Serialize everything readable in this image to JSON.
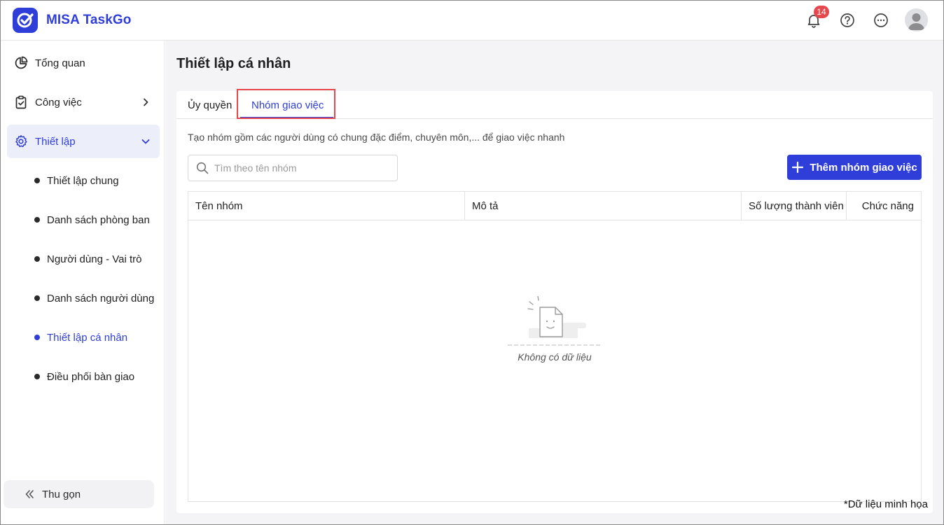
{
  "app": {
    "name": "MISA TaskGo",
    "notification_count": "14",
    "brand_color": "#2f3ed8"
  },
  "header": {
    "icons": [
      "bell-icon",
      "help-icon",
      "more-icon",
      "avatar"
    ]
  },
  "sidebar": {
    "items": [
      {
        "label": "Tổng quan",
        "icon": "pie-chart-icon"
      },
      {
        "label": "Công việc",
        "icon": "clipboard-check-icon"
      },
      {
        "label": "Thiết lập",
        "icon": "gear-icon"
      }
    ],
    "sub_items": [
      {
        "label": "Thiết lập chung"
      },
      {
        "label": "Danh sách phòng ban"
      },
      {
        "label": "Người dùng - Vai trò"
      },
      {
        "label": "Danh sách người dùng"
      },
      {
        "label": "Thiết lập cá nhân"
      },
      {
        "label": "Điều phối bàn giao"
      }
    ],
    "collapse_label": "Thu gọn"
  },
  "main": {
    "page_title": "Thiết lập cá nhân",
    "tabs": [
      {
        "label": "Ủy quyền"
      },
      {
        "label": "Nhóm giao việc"
      }
    ],
    "description": "Tạo nhóm gồm các người dùng có chung đặc điểm, chuyên môn,... để giao việc nhanh",
    "search": {
      "placeholder": "Tìm theo tên nhóm",
      "value": ""
    },
    "add_button_label": "Thêm nhóm giao việc",
    "table": {
      "columns": [
        "Tên nhóm",
        "Mô tả",
        "Số lượng thành viên",
        "Chức năng"
      ],
      "rows": [],
      "empty_text": "Không có dữ liệu"
    }
  },
  "footnote": "*Dữ liệu minh họa"
}
